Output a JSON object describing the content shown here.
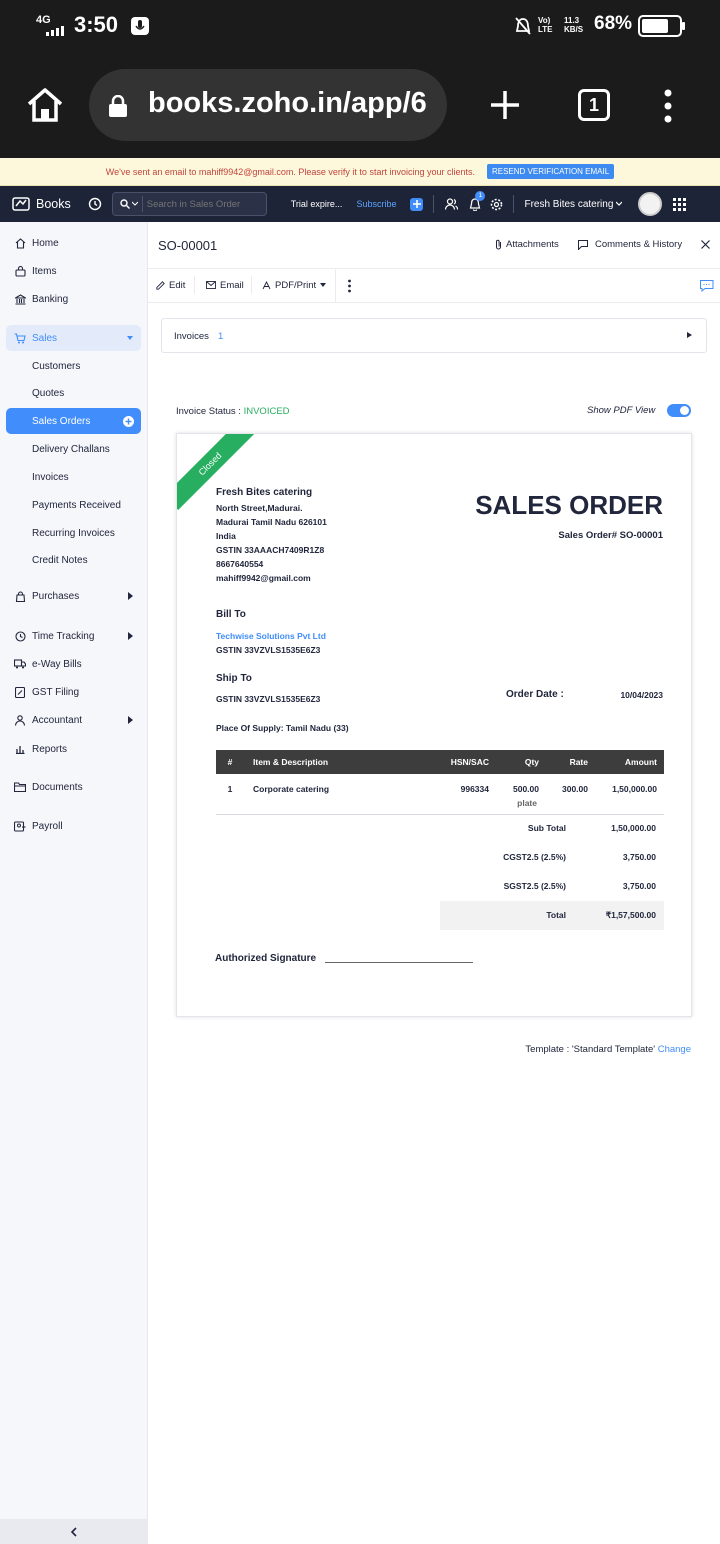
{
  "status_bar": {
    "network": "4G",
    "time": "3:50",
    "lte": "Vo) LTE",
    "speed": "11.3 KB/S",
    "battery": "68%"
  },
  "browser": {
    "url": "books.zoho.in/app/6",
    "tab_count": "1"
  },
  "banner": {
    "message": "We've sent an email to mahiff9942@gmail.com. Please verify it to start invoicing your clients.",
    "button": "RESEND VERIFICATION EMAIL"
  },
  "topnav": {
    "brand": "Books",
    "search_placeholder": "Search in Sales Order",
    "trial": "Trial expire...",
    "subscribe": "Subscribe",
    "notification_count": "1",
    "org": "Fresh Bites catering"
  },
  "sidebar": {
    "home": "Home",
    "items": "Items",
    "banking": "Banking",
    "sales": "Sales",
    "sales_sub": [
      "Customers",
      "Quotes",
      "Sales Orders",
      "Delivery Challans",
      "Invoices",
      "Payments Received",
      "Recurring Invoices",
      "Credit Notes"
    ],
    "purchases": "Purchases",
    "time_tracking": "Time Tracking",
    "eway": "e-Way Bills",
    "gst": "GST Filing",
    "accountant": "Accountant",
    "reports": "Reports",
    "documents": "Documents",
    "payroll": "Payroll"
  },
  "header": {
    "so_number": "SO-00001",
    "attachments": "Attachments",
    "comments": "Comments & History"
  },
  "toolbar": {
    "edit": "Edit",
    "email": "Email",
    "pdf": "PDF/Print"
  },
  "invoices_panel": {
    "label": "Invoices",
    "count": "1"
  },
  "invoice_status": {
    "label": "Invoice Status :",
    "value": "INVOICED",
    "pdf_toggle_label": "Show PDF View",
    "pdf_toggle_on": true
  },
  "document": {
    "ribbon": "Closed",
    "company": {
      "name": "Fresh Bites catering",
      "lines": [
        "North Street,Madurai.",
        "Madurai Tamil Nadu 626101",
        "India",
        "GSTIN 33AAACH7409R1Z8",
        "8667640554",
        "mahiff9942@gmail.com"
      ]
    },
    "title": "SALES ORDER",
    "so_line": "Sales Order# SO-00001",
    "bill_to_label": "Bill To",
    "bill_to_name": "Techwise Solutions Pvt Ltd",
    "bill_to_gstin": "GSTIN 33VZVLS1535E6Z3",
    "ship_to_label": "Ship To",
    "ship_to_gstin": "GSTIN 33VZVLS1535E6Z3",
    "order_date_label": "Order Date :",
    "order_date": "10/04/2023",
    "place_of_supply": "Place Of Supply: Tamil Nadu (33)",
    "table": {
      "headers": [
        "#",
        "Item & Description",
        "HSN/SAC",
        "Qty",
        "Rate",
        "Amount"
      ],
      "rows": [
        {
          "num": "1",
          "item": "Corporate catering",
          "hsn": "996334",
          "qty": "500.00",
          "unit": "plate",
          "rate": "300.00",
          "amount": "1,50,000.00"
        }
      ]
    },
    "sub_total_label": "Sub Total",
    "sub_total": "1,50,000.00",
    "cgst_label": "CGST2.5 (2.5%)",
    "cgst": "3,750.00",
    "sgst_label": "SGST2.5 (2.5%)",
    "sgst": "3,750.00",
    "total_label": "Total",
    "total": "₹1,57,500.00",
    "signature": "Authorized Signature"
  },
  "template": {
    "text": "Template : 'Standard Template'",
    "change": "Change"
  },
  "colors": {
    "accent": "#408dfb",
    "nav": "#1e2437",
    "ribbon": "#27ae60",
    "status_green": "#27ae60"
  }
}
